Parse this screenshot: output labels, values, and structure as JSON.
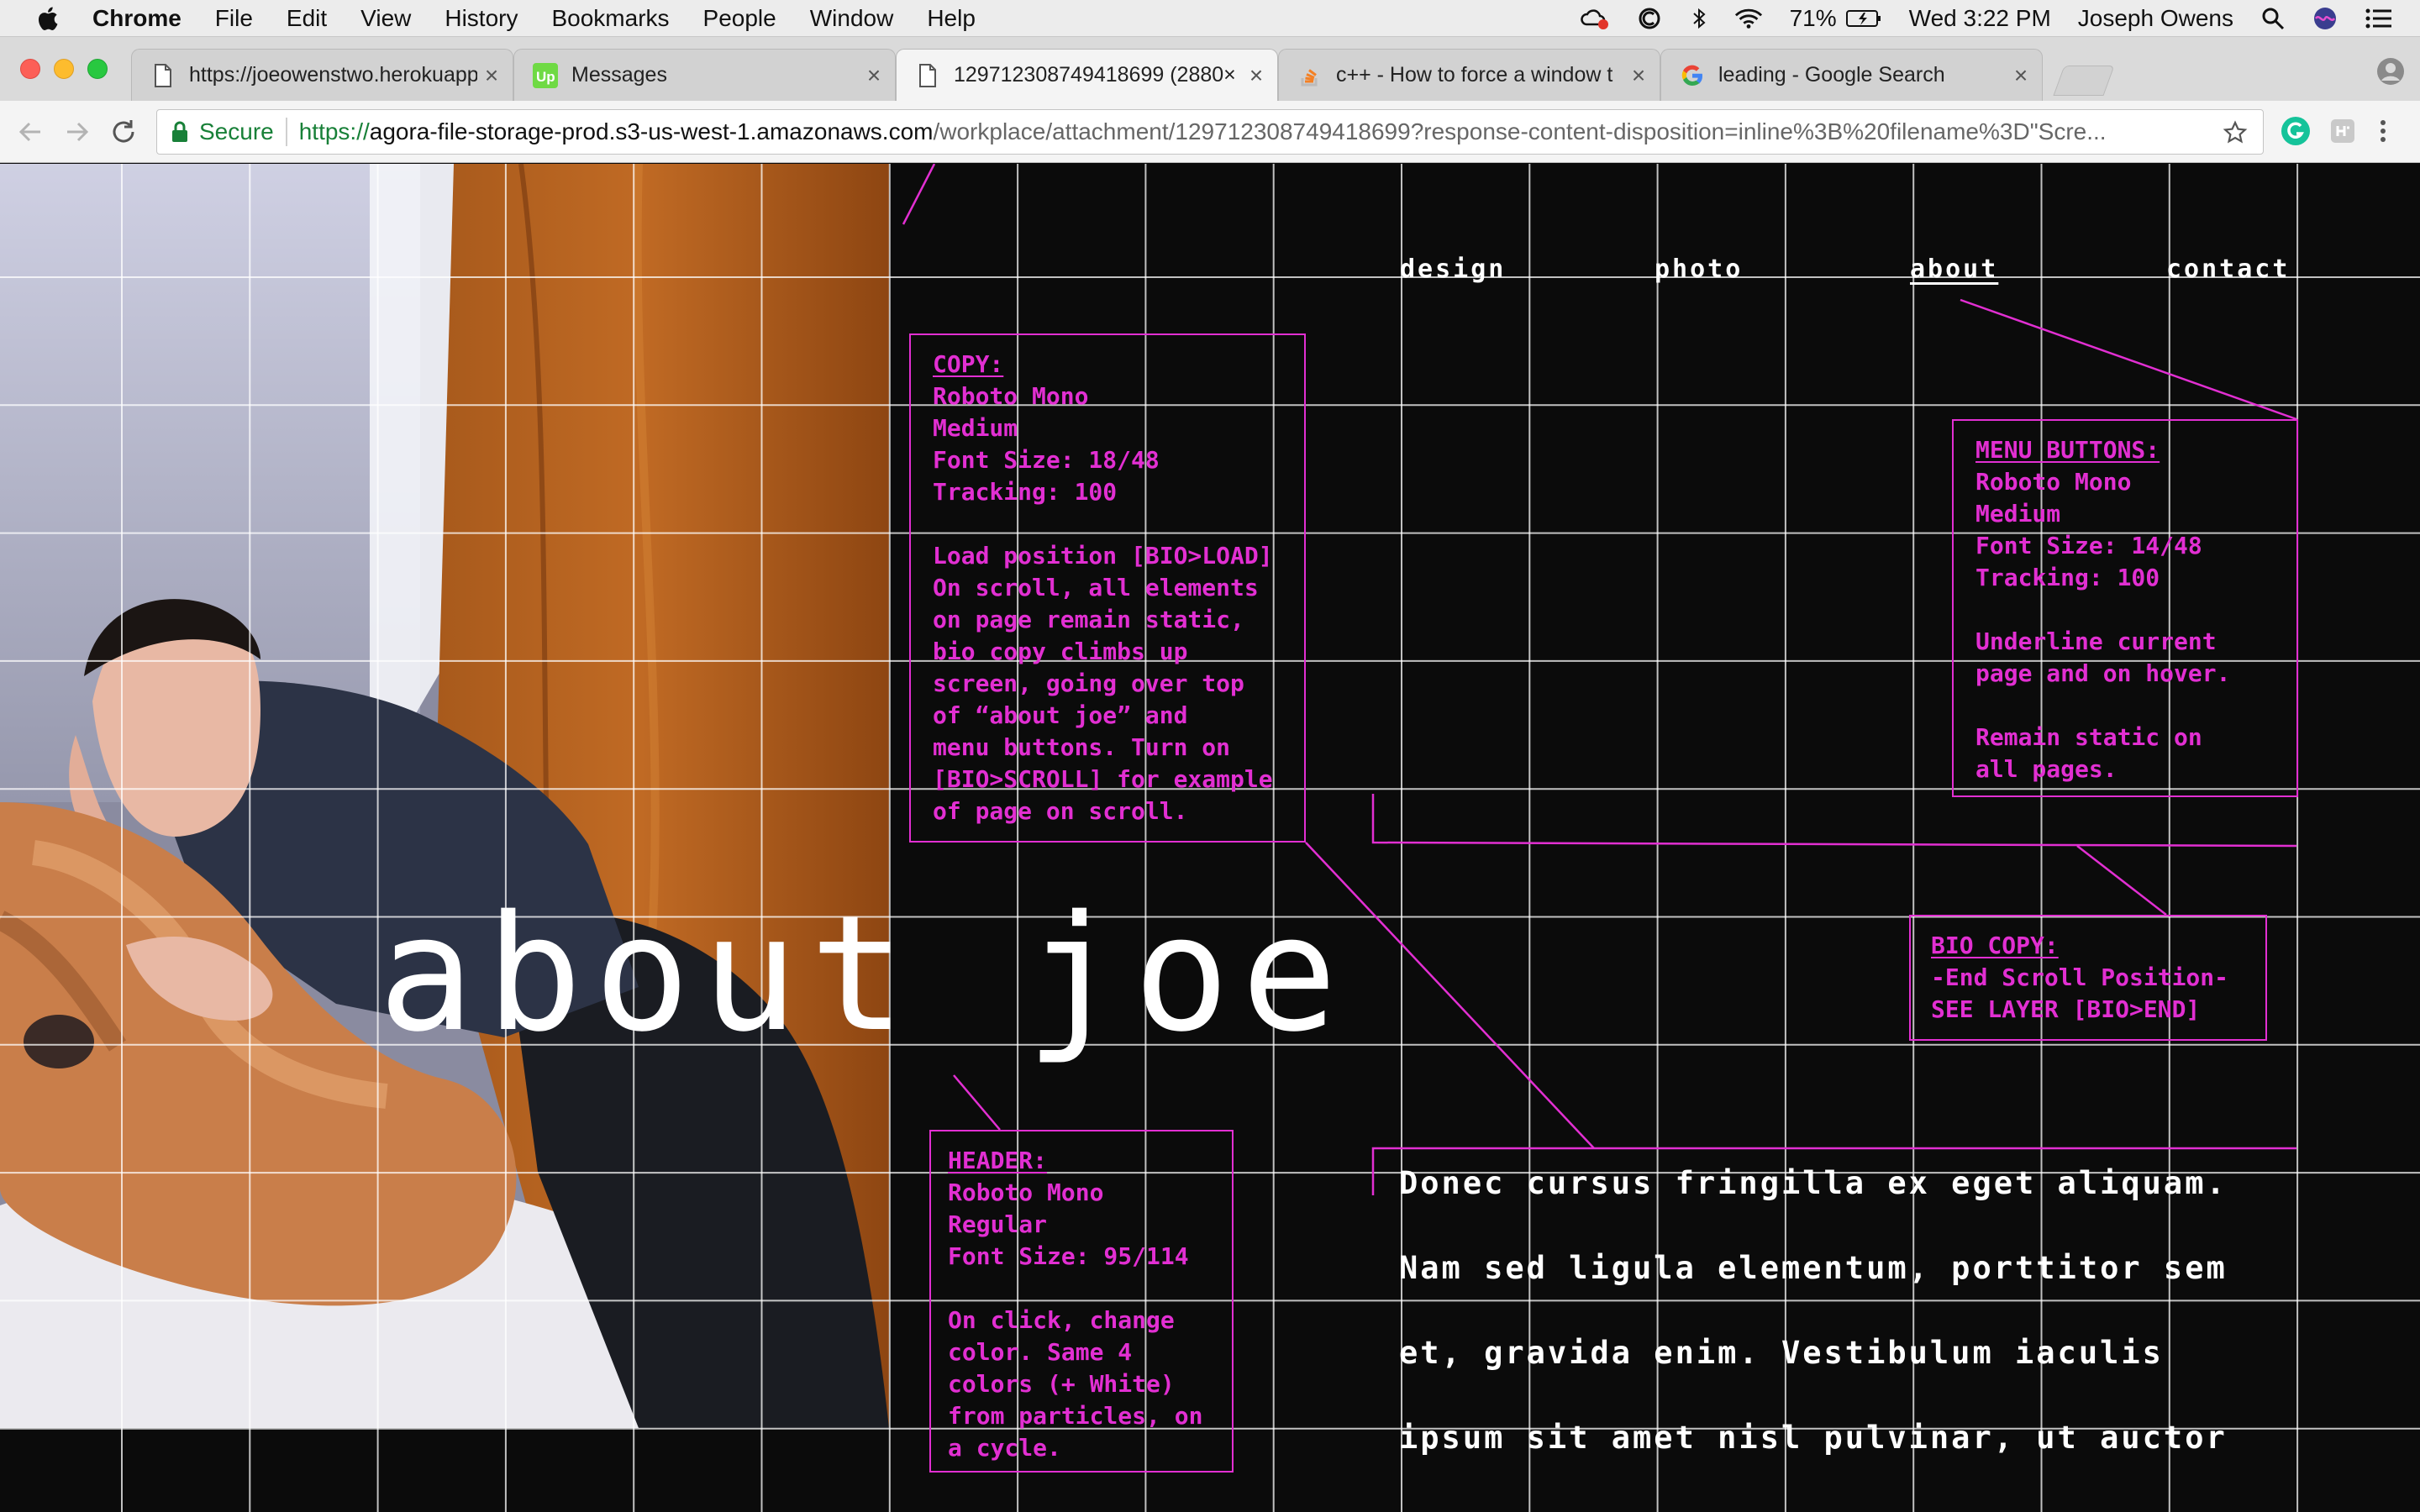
{
  "menubar": {
    "app_name": "Chrome",
    "menus": [
      "File",
      "Edit",
      "View",
      "History",
      "Bookmarks",
      "People",
      "Window",
      "Help"
    ],
    "battery": "71%",
    "clock": "Wed 3:22 PM",
    "user": "Joseph Owens"
  },
  "tabs": [
    {
      "label": "https://joeowenstwo.herokuapp",
      "icon": "document-icon"
    },
    {
      "label": "Messages",
      "icon": "upwork-icon"
    },
    {
      "label": "129712308749418699 (2880×",
      "icon": "document-icon"
    },
    {
      "label": "c++ - How to force a window t",
      "icon": "stackoverflow-icon"
    },
    {
      "label": "leading - Google Search",
      "icon": "google-icon"
    }
  ],
  "address": {
    "secure_label": "Secure",
    "scheme": "https://",
    "host": "agora-file-storage-prod.s3-us-west-1.amazonaws.com",
    "path": "/workplace/attachment/129712308749418699?response-content-disposition=inline%3B%20filename%3D\"Scre..."
  },
  "site": {
    "nav": [
      "design",
      "photo",
      "about",
      "contact"
    ],
    "current_nav": "about",
    "heading": "about joe",
    "bio_lines": [
      "Donec cursus fringilla ex eget aliquam.",
      "Nam sed ligula elementum, porttitor sem",
      "et, gravida enim. Vestibulum iaculis",
      "ipsum sit amet nisl pulvinar, ut auctor"
    ]
  },
  "annotations": {
    "copy": {
      "title": "COPY:",
      "lines": [
        "Roboto Mono",
        "Medium",
        "Font Size: 18/48",
        "Tracking: 100"
      ],
      "paragraph": "Load position [BIO>LOAD]\nOn scroll, all elements\non page remain static,\nbio copy climbs up\nscreen, going over top\nof “about joe” and\nmenu buttons. Turn on\n[BIO>SCROLL] for example\nof page on scroll."
    },
    "menu_buttons": {
      "title": "MENU BUTTONS:",
      "lines": [
        "Roboto Mono",
        "Medium",
        "Font Size: 14/48",
        "Tracking: 100"
      ],
      "paragraph1": "Underline current\npage and on hover.",
      "paragraph2": "Remain static on\nall pages."
    },
    "bio_copy": {
      "title": "BIO COPY:",
      "lines": [
        "-End Scroll Position-",
        "SEE LAYER [BIO>END]"
      ]
    },
    "header": {
      "title": "HEADER:",
      "lines": [
        "Roboto Mono",
        "Regular",
        "Font Size: 95/114"
      ],
      "paragraph": "On click, change\ncolor. Same 4\ncolors (+ White)\nfrom particles, on\na cycle."
    }
  },
  "colors": {
    "annotation": "#e22fd2",
    "page_background": "#0b0b0b",
    "grid_line": "#ffffff"
  }
}
